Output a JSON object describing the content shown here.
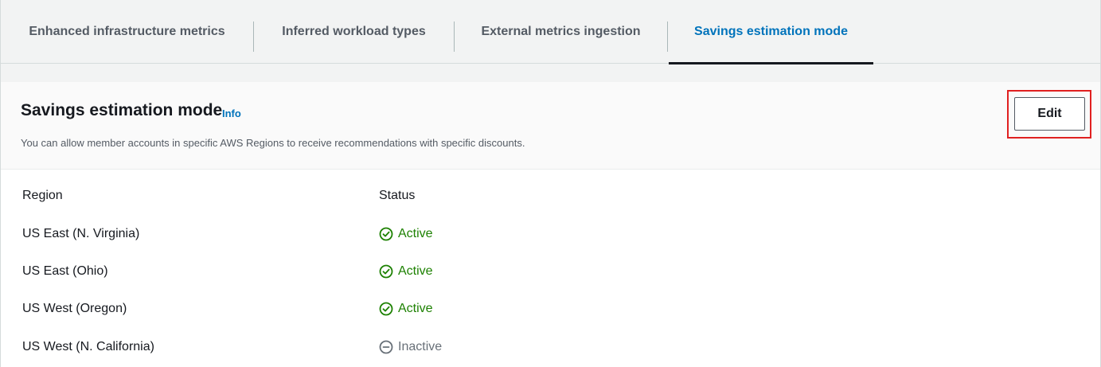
{
  "tabs": [
    {
      "label": "Enhanced infrastructure metrics",
      "active": false
    },
    {
      "label": "Inferred workload types",
      "active": false
    },
    {
      "label": "External metrics ingestion",
      "active": false
    },
    {
      "label": "Savings estimation mode",
      "active": true
    }
  ],
  "panel": {
    "title": "Savings estimation mode",
    "info_label": "Info",
    "description": "You can allow member accounts in specific AWS Regions to receive recommendations with specific discounts.",
    "edit_label": "Edit"
  },
  "table": {
    "headers": {
      "region": "Region",
      "status": "Status"
    },
    "rows": [
      {
        "region": "US East (N. Virginia)",
        "status": "Active",
        "state": "active"
      },
      {
        "region": "US East (Ohio)",
        "status": "Active",
        "state": "active"
      },
      {
        "region": "US West (Oregon)",
        "status": "Active",
        "state": "active"
      },
      {
        "region": "US West (N. California)",
        "status": "Inactive",
        "state": "inactive"
      }
    ]
  },
  "colors": {
    "active_tab": "#0073bb",
    "status_active": "#1d8102",
    "status_inactive": "#687078",
    "highlight": "#e02020"
  },
  "icons": {
    "active": "status-positive-icon",
    "inactive": "status-stopped-icon"
  }
}
